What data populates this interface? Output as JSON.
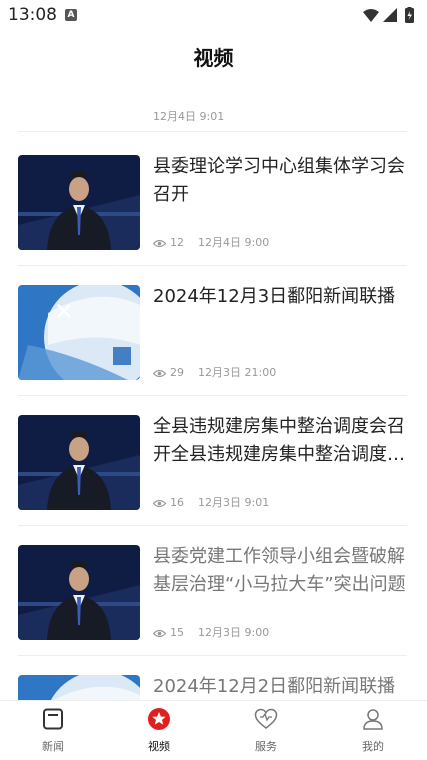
{
  "status": {
    "time": "13:08",
    "a_badge": "A"
  },
  "header": {
    "title": "视频"
  },
  "items": [
    {
      "title": "",
      "views": "",
      "date": "12月4日 9:01",
      "thumb": "anchor"
    },
    {
      "title": "县委理论学习中心组集体学习会召开",
      "views": "12",
      "date": "12月4日 9:00",
      "thumb": "anchor"
    },
    {
      "title": "2024年12月3日鄱阳新闻联播",
      "views": "29",
      "date": "12月3日 21:00",
      "thumb": "globe"
    },
    {
      "title": "全县违规建房集中整治调度会召开全县违规建房集中整治调度会召开",
      "views": "16",
      "date": "12月3日 9:01",
      "thumb": "anchor"
    },
    {
      "title": "县委党建工作领导小组会暨破解基层治理“小马拉大车”突出问题",
      "views": "15",
      "date": "12月3日 9:00",
      "thumb": "anchor",
      "grey": true
    },
    {
      "title": "2024年12月2日鄱阳新闻联播",
      "views": "",
      "date": "",
      "thumb": "globe",
      "grey": true
    }
  ],
  "tabs": [
    {
      "label": "新闻",
      "icon": "news-icon",
      "active": false
    },
    {
      "label": "视频",
      "icon": "video-icon",
      "active": true
    },
    {
      "label": "服务",
      "icon": "heart-icon",
      "active": false
    },
    {
      "label": "我的",
      "icon": "user-icon",
      "active": false
    }
  ],
  "colors": {
    "accent": "#e02020",
    "text": "#222222",
    "meta": "#999999"
  }
}
